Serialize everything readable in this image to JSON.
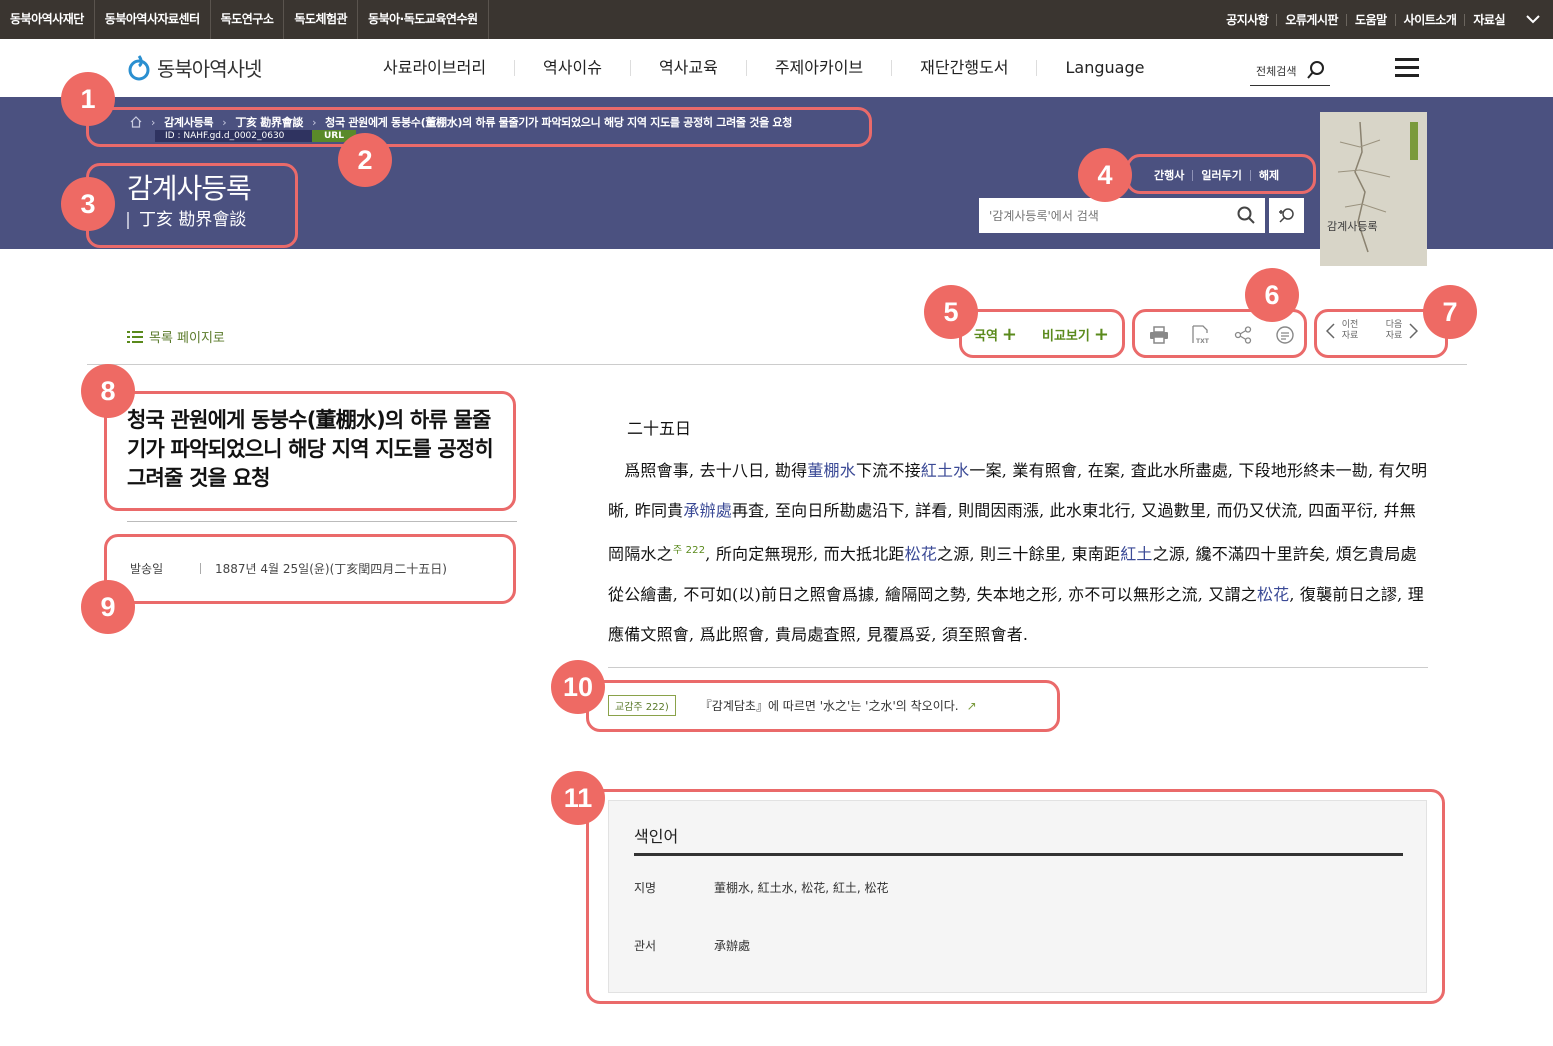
{
  "topbar": {
    "left_items": [
      "동북아역사재단",
      "동북아역사자료센터",
      "독도연구소",
      "독도체험관",
      "동북아·독도교육연수원"
    ],
    "right_items": [
      "공지사항",
      "오류게시판",
      "도움말",
      "사이트소개",
      "자료실"
    ]
  },
  "nav": {
    "logo_text": "동북아역사넷",
    "menu": [
      "사료라이브러리",
      "역사이슈",
      "역사교육",
      "주제아카이브",
      "재단간행도서",
      "Language"
    ],
    "search_label": "전체검색"
  },
  "banner": {
    "breadcrumb": [
      "감계사등록",
      "丁亥 勘界會談",
      "청국 관원에게 동붕수(董棚水)의 하류 물줄기가 파악되었으니 해당 지역 지도를 공정히 그려줄 것을 요청"
    ],
    "id_text": "ID : NAHF.gd.d_0002_0630",
    "url_label": "URL",
    "title": "감계사등록",
    "subtitle": "丁亥 勘界會談",
    "links": [
      "간행사",
      "일러두기",
      "해제"
    ],
    "search_placeholder": "'감계사등록'에서 검색",
    "book_cover_text": "감계사등록"
  },
  "toolbar": {
    "list_link": "목록 페이지로",
    "translate_btn": "국역",
    "compare_btn": "비교보기",
    "prev_label_1": "이전",
    "prev_label_2": "자료",
    "next_label_1": "다음",
    "next_label_2": "자료"
  },
  "article": {
    "title": "청국 관원에게 동붕수(董棚水)의 하류 물줄기가 파악되었으니 해당 지역 지도를 공정히 그려줄 것을 요청",
    "meta_key": "발송일",
    "meta_value": "1887년 4월 25일(윤)(丁亥閏四月二十五日)",
    "date": "二十五日",
    "body_segments": [
      {
        "t": "爲照會事, 去十八日, 勘得"
      },
      {
        "t": "董棚水",
        "e": true
      },
      {
        "t": "下流不接"
      },
      {
        "t": "紅土水",
        "e": true
      },
      {
        "t": "一案, 業有照會, 在案, 査此水所盡處, 下段地形終未一勘, 有欠明晰, 昨同貴"
      },
      {
        "t": "承辦處",
        "e": true
      },
      {
        "t": "再査, 至向日所勘處沿下, 詳看, 則間因雨漲, 此水東北行, 又過數里, 而仍又伏流, 四面平衍, 幷無岡隔水之"
      },
      {
        "t": "주 222",
        "sup": true
      },
      {
        "t": ", 所向定無現形, 而大抵北距"
      },
      {
        "t": "松花",
        "e": true
      },
      {
        "t": "之源, 則三十餘里, 東南距"
      },
      {
        "t": "紅土",
        "e": true
      },
      {
        "t": "之源, 纔不滿四十里許矣, 煩乞貴局處從公繪畵, 不可如(以)前日之照會爲據, 繪隔岡之勢, 失本地之形, 亦不可以無形之流, 又謂之"
      },
      {
        "t": "松花",
        "e": true
      },
      {
        "t": ", 復襲前日之謬, 理應備文照會, 爲此照會, 貴局處査照, 見覆爲妥, 須至照會者."
      }
    ],
    "note_tag": "교감주 222)",
    "note_text": "『감계담초』에 따르면 '水之'는 '之水'의 착오이다."
  },
  "index": {
    "heading": "색인어",
    "rows": [
      {
        "key": "지명",
        "value": "董棚水, 紅土水, 松花, 紅土, 松花"
      },
      {
        "key": "관서",
        "value": "承辦處"
      }
    ]
  },
  "annotations": [
    "1",
    "2",
    "3",
    "4",
    "5",
    "6",
    "7",
    "8",
    "9",
    "10",
    "11"
  ],
  "colors": {
    "banner": "#4b5180",
    "topbar": "#3a3530",
    "accent_green": "#5a8a1c",
    "entity_blue": "#3b4a96",
    "annotation_red": "#ee6a64"
  }
}
